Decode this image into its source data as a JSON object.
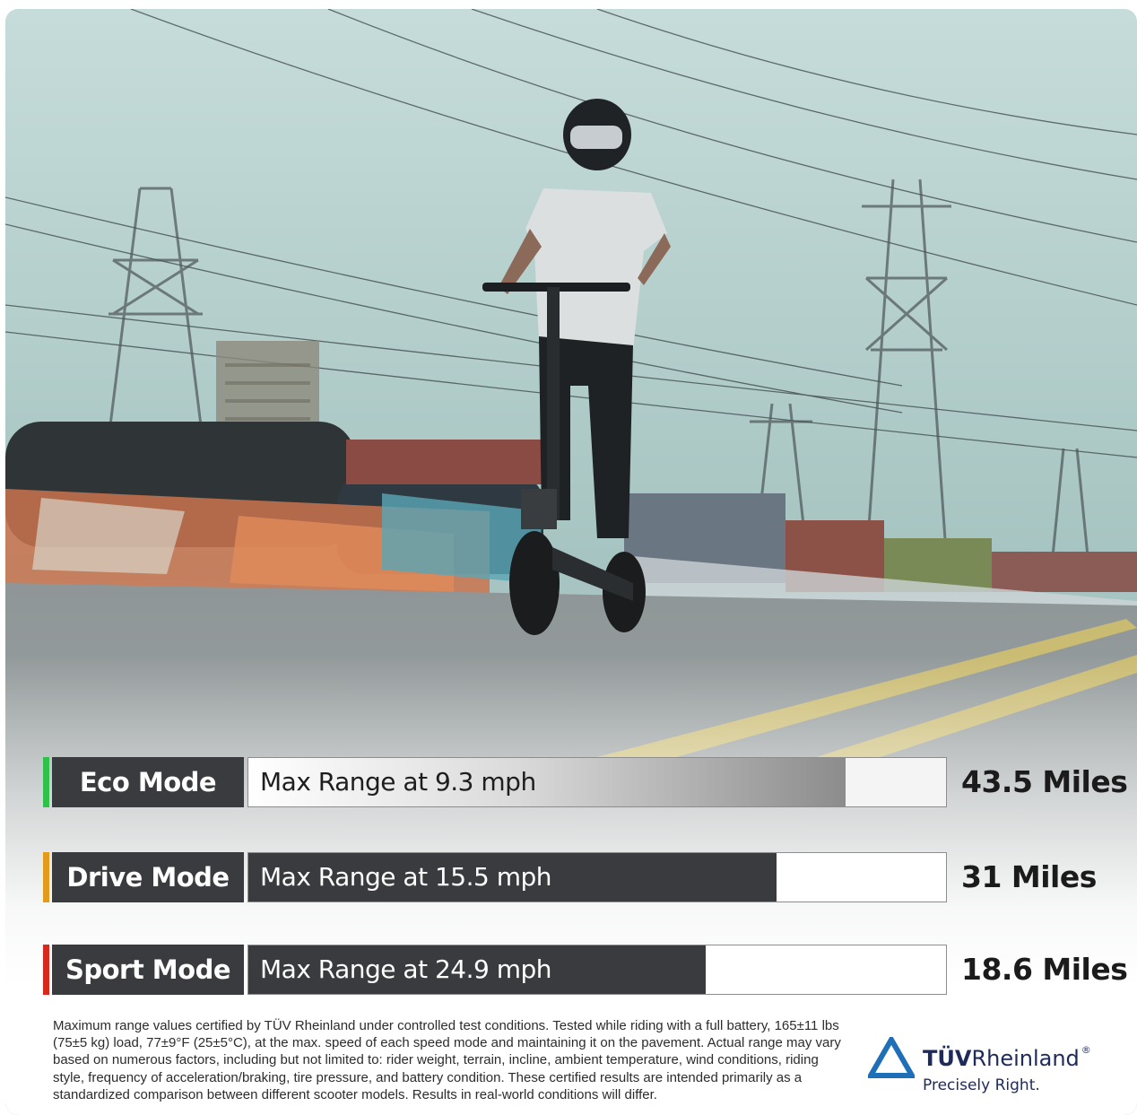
{
  "modes": [
    {
      "name": "Eco Mode",
      "bar_text": "Max Range at 9.3 mph",
      "range": "43.5 Miles",
      "fill_fraction": 0.856,
      "accent": "#2ec24a",
      "fill_style": "gradient"
    },
    {
      "name": "Drive Mode",
      "bar_text": "Max Range at 15.5 mph",
      "range": "31 Miles",
      "fill_fraction": 0.757,
      "accent": "#e39b1c",
      "fill_style": "solid"
    },
    {
      "name": "Sport Mode",
      "bar_text": "Max Range at 24.9 mph",
      "range": "18.6 Miles",
      "fill_fraction": 0.655,
      "accent": "#d9281c",
      "fill_style": "solid"
    }
  ],
  "disclaimer": "Maximum range values certified by TÜV Rheinland under controlled test conditions. Tested while riding with a full battery, 165±11 lbs (75±5 kg) load, 77±9°F (25±5°C), at the max. speed of each speed mode and maintaining it on the pavement. Actual range may vary based on numerous factors, including but not limited to: rider weight, terrain, incline, ambient temperature, wind conditions, riding style, frequency of acceleration/braking, tire pressure, and battery condition. These certified results are intended primarily as a standardized comparison between different scooter models.  Results in real-world conditions will differ.",
  "logo": {
    "brand_bold": "TÜV",
    "brand_regular": "Rheinland",
    "registered": "®",
    "slogan": "Precisely Right."
  },
  "colors": {
    "bar_dark": "#3a3b3f",
    "logo_blue": "#1e2a5a",
    "sky": "#a9c6c3"
  }
}
